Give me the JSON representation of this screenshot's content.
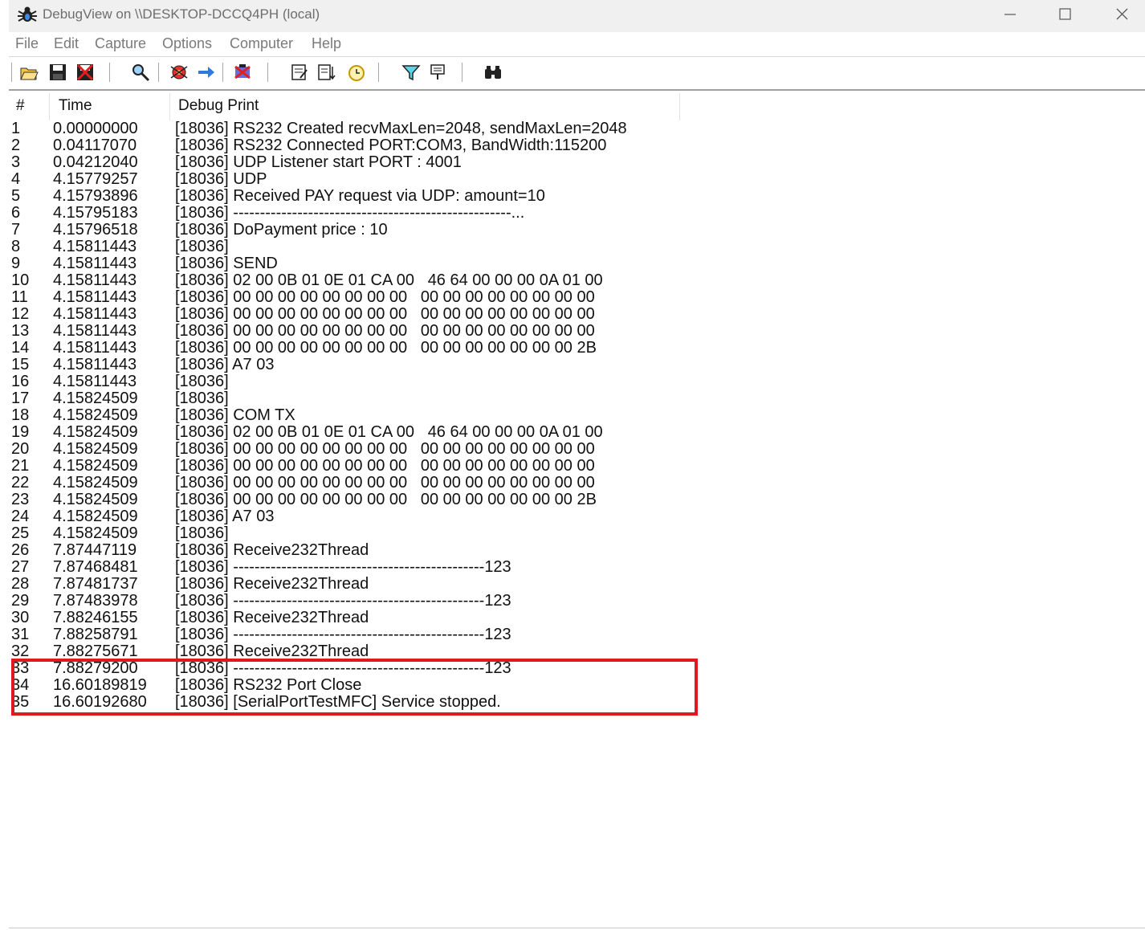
{
  "window": {
    "title": "DebugView on \\\\DESKTOP-DCCQ4PH (local)"
  },
  "menu": [
    "File",
    "Edit",
    "Capture",
    "Options",
    "Computer",
    "Help"
  ],
  "toolbar_icons": [
    "open-icon",
    "save-icon",
    "clear-display-icon",
    "find-icon",
    "capture-icon",
    "capture-forward-icon",
    "clear-icon",
    "timestamp-icon",
    "scroll-icon",
    "clock-icon",
    "filter-icon",
    "highlight-icon",
    "find-binoculars-icon"
  ],
  "columns": {
    "num": "#",
    "time": "Time",
    "msg": "Debug Print"
  },
  "rows": [
    {
      "n": "1",
      "t": "0.00000000",
      "m": "[18036] RS232 Created recvMaxLen=2048, sendMaxLen=2048"
    },
    {
      "n": "2",
      "t": "0.04117070",
      "m": "[18036] RS232 Connected PORT:COM3, BandWidth:115200"
    },
    {
      "n": "3",
      "t": "0.04212040",
      "m": "[18036] UDP Listener start PORT : 4001"
    },
    {
      "n": "4",
      "t": "4.15779257",
      "m": "[18036] UDP"
    },
    {
      "n": "5",
      "t": "4.15793896",
      "m": "[18036] Received PAY request via UDP: amount=10"
    },
    {
      "n": "6",
      "t": "4.15795183",
      "m": "[18036] ----------------------------------------------------..."
    },
    {
      "n": "7",
      "t": "4.15796518",
      "m": "[18036] DoPayment price : 10"
    },
    {
      "n": "8",
      "t": "4.15811443",
      "m": "[18036]"
    },
    {
      "n": "9",
      "t": "4.15811443",
      "m": "[18036] SEND"
    },
    {
      "n": "10",
      "t": "4.15811443",
      "m": "[18036] 02 00 0B 01 0E 01 CA 00   46 64 00 00 00 0A 01 00"
    },
    {
      "n": "11",
      "t": "4.15811443",
      "m": "[18036] 00 00 00 00 00 00 00 00   00 00 00 00 00 00 00 00"
    },
    {
      "n": "12",
      "t": "4.15811443",
      "m": "[18036] 00 00 00 00 00 00 00 00   00 00 00 00 00 00 00 00"
    },
    {
      "n": "13",
      "t": "4.15811443",
      "m": "[18036] 00 00 00 00 00 00 00 00   00 00 00 00 00 00 00 00"
    },
    {
      "n": "14",
      "t": "4.15811443",
      "m": "[18036] 00 00 00 00 00 00 00 00   00 00 00 00 00 00 00 2B"
    },
    {
      "n": "15",
      "t": "4.15811443",
      "m": "[18036] A7 03"
    },
    {
      "n": "16",
      "t": "4.15811443",
      "m": "[18036]"
    },
    {
      "n": "17",
      "t": "4.15824509",
      "m": "[18036]"
    },
    {
      "n": "18",
      "t": "4.15824509",
      "m": "[18036] COM TX"
    },
    {
      "n": "19",
      "t": "4.15824509",
      "m": "[18036] 02 00 0B 01 0E 01 CA 00   46 64 00 00 00 0A 01 00"
    },
    {
      "n": "20",
      "t": "4.15824509",
      "m": "[18036] 00 00 00 00 00 00 00 00   00 00 00 00 00 00 00 00"
    },
    {
      "n": "21",
      "t": "4.15824509",
      "m": "[18036] 00 00 00 00 00 00 00 00   00 00 00 00 00 00 00 00"
    },
    {
      "n": "22",
      "t": "4.15824509",
      "m": "[18036] 00 00 00 00 00 00 00 00   00 00 00 00 00 00 00 00"
    },
    {
      "n": "23",
      "t": "4.15824509",
      "m": "[18036] 00 00 00 00 00 00 00 00   00 00 00 00 00 00 00 2B"
    },
    {
      "n": "24",
      "t": "4.15824509",
      "m": "[18036] A7 03"
    },
    {
      "n": "25",
      "t": "4.15824509",
      "m": "[18036]"
    },
    {
      "n": "26",
      "t": "7.87447119",
      "m": "[18036] Receive232Thread"
    },
    {
      "n": "27",
      "t": "7.87468481",
      "m": "[18036] -----------------------------------------------123"
    },
    {
      "n": "28",
      "t": "7.87481737",
      "m": "[18036] Receive232Thread"
    },
    {
      "n": "29",
      "t": "7.87483978",
      "m": "[18036] -----------------------------------------------123"
    },
    {
      "n": "30",
      "t": "7.88246155",
      "m": "[18036] Receive232Thread"
    },
    {
      "n": "31",
      "t": "7.88258791",
      "m": "[18036] -----------------------------------------------123"
    },
    {
      "n": "32",
      "t": "7.88275671",
      "m": "[18036] Receive232Thread"
    },
    {
      "n": "33",
      "t": "7.88279200",
      "m": "[18036] -----------------------------------------------123"
    },
    {
      "n": "34",
      "t": "16.60189819",
      "m": "[18036] RS232 Port Close"
    },
    {
      "n": "35",
      "t": "16.60192680",
      "m": "[18036] [SerialPortTestMFC] Service stopped."
    }
  ],
  "highlight_color": "#e0191f"
}
